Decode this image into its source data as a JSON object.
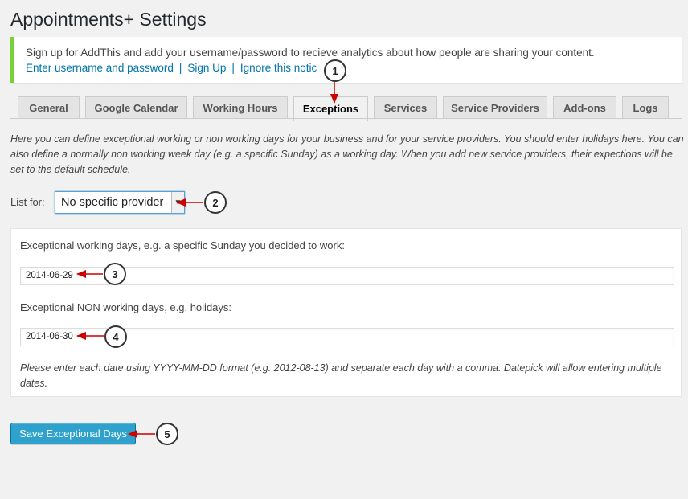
{
  "page": {
    "title": "Appointments+ Settings"
  },
  "notice": {
    "message": "Sign up for AddThis and add your username/password to recieve analytics about how people are sharing your content.",
    "links": [
      "Enter username and password",
      "Sign Up",
      "Ignore this notic"
    ],
    "separator": "|",
    "accent_color": "#7ad03a"
  },
  "tabs": [
    {
      "label": "General"
    },
    {
      "label": "Google Calendar"
    },
    {
      "label": "Working Hours"
    },
    {
      "label": "Exceptions",
      "active": true
    },
    {
      "label": "Services"
    },
    {
      "label": "Service Providers"
    },
    {
      "label": "Add-ons"
    },
    {
      "label": "Logs"
    }
  ],
  "intro": "Here you can define exceptional working or non working days for your business and for your service providers. You should enter holidays here. You can also define a normally non working week day (e.g. a specific Sunday) as a working day. When you add new service providers, their expections will be set to the default schedule.",
  "list_for": {
    "label": "List for:",
    "selected": "No specific provider"
  },
  "working_days": {
    "label": "Exceptional working days, e.g. a specific Sunday you decided to work:",
    "value": "2014-06-29"
  },
  "non_working_days": {
    "label": "Exceptional NON working days, e.g. holidays:",
    "value": "2014-06-30"
  },
  "format_note": "Please enter each date using YYYY-MM-DD format (e.g. 2012-08-13) and separate each day with a comma. Datepick will allow entering multiple dates.",
  "save_button": {
    "label": "Save Exceptional Days",
    "color": "#2ea2cc"
  },
  "callouts": [
    "1",
    "2",
    "3",
    "4",
    "5"
  ],
  "arrow_color": "#cc0000"
}
